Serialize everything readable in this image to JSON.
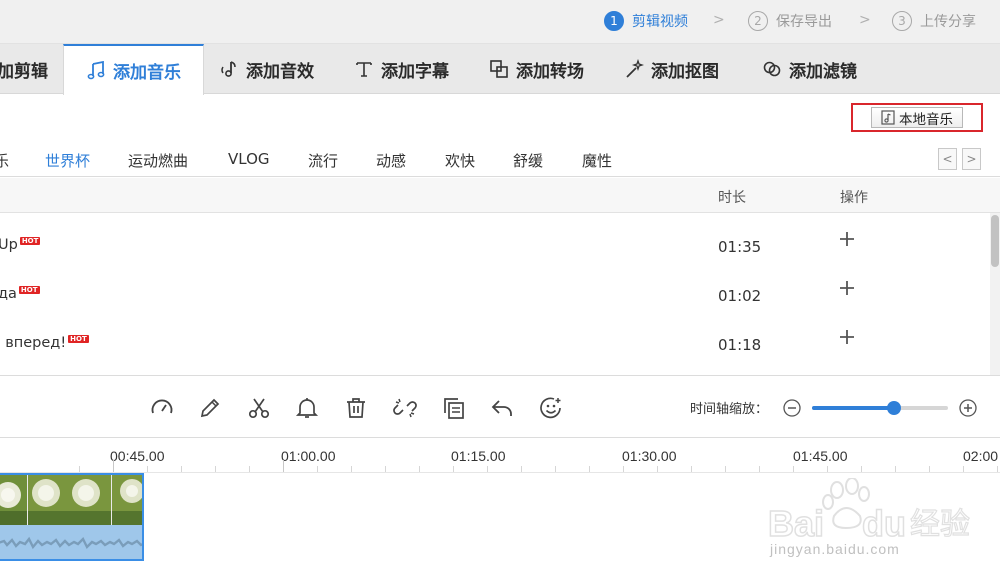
{
  "steps": [
    {
      "num": "1",
      "label": "剪辑视频",
      "active": true
    },
    {
      "num": "2",
      "label": "保存导出",
      "active": false
    },
    {
      "num": "3",
      "label": "上传分享",
      "active": false
    }
  ],
  "tabs": [
    {
      "label": "加剪辑",
      "icon": "edit-icon"
    },
    {
      "label": "添加音乐",
      "icon": "music-note-icon",
      "active": true
    },
    {
      "label": "添加音效",
      "icon": "sound-effect-icon"
    },
    {
      "label": "添加字幕",
      "icon": "text-icon"
    },
    {
      "label": "添加转场",
      "icon": "transition-icon"
    },
    {
      "label": "添加抠图",
      "icon": "magic-wand-icon"
    },
    {
      "label": "添加滤镜",
      "icon": "filter-icon"
    }
  ],
  "local_music_label": "本地音乐",
  "categories": {
    "items": [
      "乐",
      "世界杯",
      "运动燃曲",
      "VLOG",
      "流行",
      "动感",
      "欢快",
      "舒缓",
      "魔性"
    ],
    "active": "世界杯"
  },
  "list": {
    "col_duration": "时长",
    "col_action": "操作",
    "hot_badge": "HOT",
    "rows": [
      {
        "title": "Up",
        "duration": "01:35",
        "hot": true
      },
      {
        "title": "да",
        "duration": "01:02",
        "hot": true
      },
      {
        "title": ", вперед!",
        "duration": "01:18",
        "hot": true
      }
    ]
  },
  "toolbar": {
    "tools": [
      "speed-icon",
      "pencil-icon",
      "scissors-icon",
      "bell-icon",
      "trash-icon",
      "unlink-icon",
      "copy-icon",
      "undo-icon",
      "emoji-icon"
    ],
    "zoom_label": "时间轴缩放：",
    "zoom_level": 0.6
  },
  "timeline": {
    "ticks": [
      "00:45.00",
      "01:00.00",
      "01:15.00",
      "01:30.00",
      "01:45.00",
      "02:00"
    ]
  },
  "watermark": {
    "logo": "Baidu经验",
    "url": "jingyan.baidu.com"
  },
  "colors": {
    "accent": "#2f7fd8",
    "highlight_box": "#d9262c",
    "hot_badge": "#e02424"
  }
}
